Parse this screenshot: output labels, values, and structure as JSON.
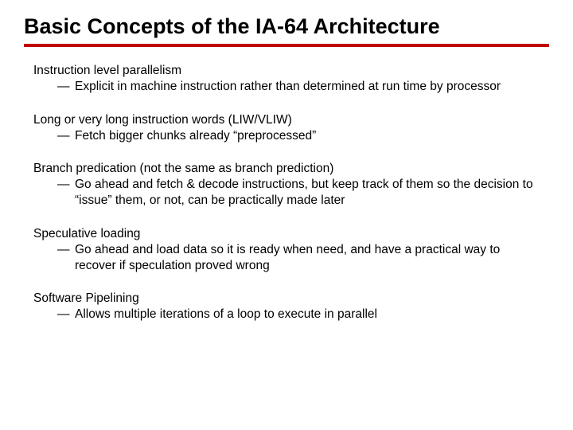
{
  "title": "Basic Concepts of the IA-64 Architecture",
  "dash": "—",
  "topics": [
    {
      "head": "Instruction level parallelism",
      "sub": "Explicit in machine instruction rather than determined at run time by processor"
    },
    {
      "head": "Long or very long instruction words (LIW/VLIW)",
      "sub": "Fetch bigger chunks already “preprocessed”"
    },
    {
      "head": "Branch predication (not the same as branch prediction)",
      "sub": "Go ahead and fetch & decode instructions, but keep track of them so the decision to “issue” them, or not, can be practically made later"
    },
    {
      "head": "Speculative loading",
      "sub": "Go ahead and load data so it is ready when need, and have a practical way to recover if speculation proved wrong"
    },
    {
      "head": "Software Pipelining",
      "sub": "Allows multiple iterations of a loop to execute in parallel"
    }
  ]
}
